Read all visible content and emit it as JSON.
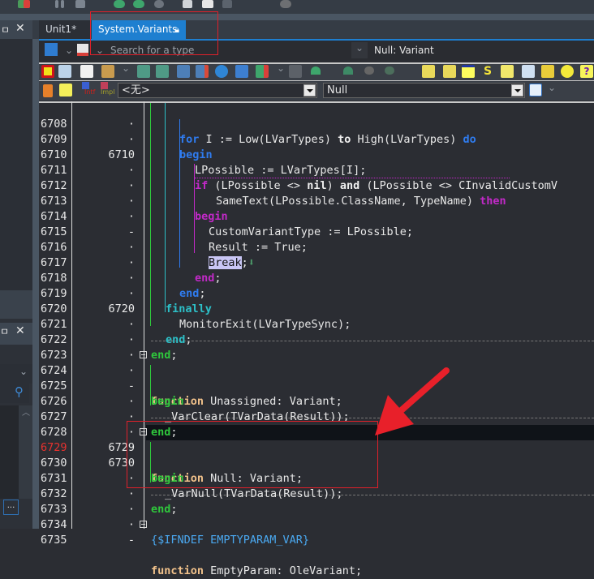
{
  "window": {
    "tabs": [
      {
        "label": "Unit1*",
        "modified": true,
        "active": false
      },
      {
        "label": "System.Variants",
        "locked": true,
        "active": true
      }
    ]
  },
  "nav_bar": {
    "search_placeholder": "Search for a type",
    "method_selector": "Null: Variant"
  },
  "cnpack_toolbar": {
    "icons": [
      "toggle-maximize-icon",
      "info-icon",
      "new-item-icon",
      "open-folder-icon",
      "chevron-down-icon",
      "save-icon",
      "edit-save-icon",
      "add-unit-icon",
      "remove-unit-icon",
      "gear-tool-icon",
      "pyramid-icon",
      "run-debug-icon",
      "chevron-down-icon",
      "stop-icon",
      "step-icon",
      "step-over-icon",
      "trace-icon",
      "run-to-cursor-icon",
      "new-component-icon",
      "edit-note-icon",
      "window-list-icon",
      "script-icon",
      "file-swap-icon",
      "numbers-icon",
      "code-editor-icon",
      "settings-icon",
      "help-icon",
      "about-icon"
    ]
  },
  "procedure_bar": {
    "icons": [
      "structure-icon",
      "unit-file-icon",
      "interface-icon",
      "implementation-icon"
    ],
    "intf_label": "Intf",
    "impl_label": "Impl",
    "class_combo": "<无>",
    "proc_combo": "Null"
  },
  "editor": {
    "current_line": 6729,
    "lines": [
      {
        "n": "6708",
        "m": "·"
      },
      {
        "n": "6709",
        "m": "·"
      },
      {
        "n": "6710",
        "m": "6710"
      },
      {
        "n": "6711",
        "m": "·"
      },
      {
        "n": "6712",
        "m": "·"
      },
      {
        "n": "6713",
        "m": "·"
      },
      {
        "n": "6714",
        "m": "·"
      },
      {
        "n": "6715",
        "m": "-"
      },
      {
        "n": "6716",
        "m": "·"
      },
      {
        "n": "6717",
        "m": "·"
      },
      {
        "n": "6718",
        "m": "·"
      },
      {
        "n": "6719",
        "m": "·"
      },
      {
        "n": "6720",
        "m": "6720"
      },
      {
        "n": "6721",
        "m": "·"
      },
      {
        "n": "6722",
        "m": "·"
      },
      {
        "n": "6723",
        "m": "·"
      },
      {
        "n": "6724",
        "m": "·"
      },
      {
        "n": "6725",
        "m": "-"
      },
      {
        "n": "6726",
        "m": "·"
      },
      {
        "n": "6727",
        "m": "·"
      },
      {
        "n": "6728",
        "m": "·"
      },
      {
        "n": "6729",
        "m": "6729"
      },
      {
        "n": "6730",
        "m": "6730"
      },
      {
        "n": "6731",
        "m": "·"
      },
      {
        "n": "6732",
        "m": "·"
      },
      {
        "n": "6733",
        "m": "·"
      },
      {
        "n": "6734",
        "m": "·"
      },
      {
        "n": "6735",
        "m": "-"
      }
    ],
    "code": {
      "l6708_kw1": "for",
      "l6708_a": " I := Low(LVarTypes) ",
      "l6708_kw2": "to",
      "l6708_b": " High(LVarTypes) ",
      "l6708_kw3": "do",
      "l6709": "begin",
      "l6710": "LPossible := LVarTypes[I];",
      "l6711_kw": "if",
      "l6711_a": " (LPossible <> ",
      "l6711_nil": "nil",
      "l6711_b": ") ",
      "l6711_and": "and",
      "l6711_c": " (LPossible <> CInvalidCustomV",
      "l6712_a": "SameText(LPossible.ClassName, TypeName) ",
      "l6712_kw": "then",
      "l6713": "begin",
      "l6714": "CustomVariantType := LPossible;",
      "l6715": "Result := True;",
      "l6716_break": "Break",
      "l6716_semi": ";",
      "l6717_kw": "end",
      "l6717_semi": ";",
      "l6718_kw": "end",
      "l6718_semi": ";",
      "l6719": "finally",
      "l6720": "MonitorExit(LVarTypeSync);",
      "l6721_kw": "end",
      "l6721_semi": ";",
      "l6722_kw": "end",
      "l6722_semi": ";",
      "l6724_kw": "function",
      "l6724_a": " Unassigned: Variant;",
      "l6725": "begin",
      "l6726": "_VarClear(TVarData(Result));",
      "l6727_kw": "end",
      "l6727_semi": ";",
      "l6729_kw": "function",
      "l6729_a": " Null: Variant;",
      "l6730": "begin",
      "l6731": "_VarNull(TVarData(Result));",
      "l6732_kw": "end",
      "l6732_semi": ";",
      "l6734": "{$IFNDEF EMPTYPARAM_VAR}",
      "l6735_kw": "function",
      "l6735_a": " EmptyParam: OleVariant;"
    }
  },
  "left_panel": {
    "more_button": "..."
  },
  "annotations": {
    "highlight_color": "#e0202a"
  }
}
